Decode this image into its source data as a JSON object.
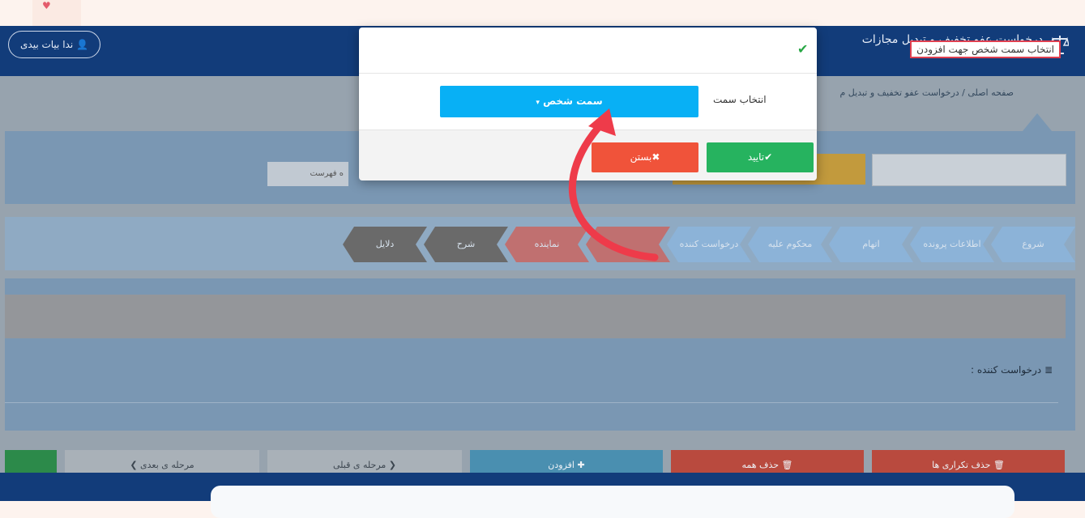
{
  "header": {
    "app_title": "درخواست عفو تخفیف و تبدیل مجازات",
    "user_label": "ندا بیات بیدی",
    "user_icon": "user-icon",
    "logo_icon": "scales-icon"
  },
  "breadcrumb": {
    "home": "صفحه اصلی",
    "separator": "/",
    "current": "درخواست عفو تخفیف و تبدیل م"
  },
  "filters": {
    "list_label": "ه فهرست"
  },
  "steps": [
    {
      "label": "شروع",
      "color": "#8cb3d8"
    },
    {
      "label": "اطلاعات پرونده",
      "color": "#8cb3d8"
    },
    {
      "label": "اتهام",
      "color": "#8cb3d8"
    },
    {
      "label": "محکوم علیه",
      "color": "#8cb3d8"
    },
    {
      "label": "درخواست کننده",
      "color": "#8cb3d8"
    },
    {
      "label": "",
      "color": "#c07070"
    },
    {
      "label": "نماینده",
      "color": "#c07070"
    },
    {
      "label": "شرح",
      "color": "#6a6a6a"
    },
    {
      "label": "دلایل",
      "color": "#6a6a6a"
    }
  ],
  "section": {
    "requester_label": "درخواست کننده :",
    "requester_icon": "list-icon"
  },
  "buttons": {
    "delete_duplicates": "حذف تکراری ها",
    "delete_all": "حذف همه",
    "add": "افزودن",
    "previous": "مرحله ی قبلی",
    "next": "مرحله ی بعدی"
  },
  "modal": {
    "title": "انتخاب سمت شخص جهت افزودن",
    "role_label": "انتخاب سمت",
    "role_value": "سمت شخص",
    "confirm": "تایید",
    "close": "بستن"
  },
  "colors": {
    "header": "#123c7a",
    "select": "#08b0f5",
    "confirm": "#26b35f",
    "close": "#f0533a",
    "highlight": "#e04050"
  }
}
